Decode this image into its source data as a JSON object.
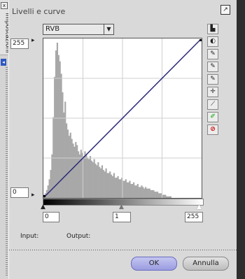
{
  "sidebar": {
    "label": "Impostazioni",
    "close_glyph": "x",
    "arrow_glyph": "◂"
  },
  "dialog": {
    "title": "Livelli e curve",
    "popout_icon": "↗",
    "channel": "RVB",
    "dropdown_icon": "▼",
    "output_max": "255",
    "output_min": "0",
    "input_black": "0",
    "gamma": "1",
    "input_white": "255",
    "input_label": "Input:",
    "output_label": "Output:",
    "ok_label": "OK",
    "cancel_label": "Annulla"
  },
  "tools": [
    {
      "name": "histogram-tool-icon",
      "glyph": "▙"
    },
    {
      "name": "contrast-tool-icon",
      "glyph": "◐"
    },
    {
      "name": "white-eyedropper-icon",
      "glyph": "✎"
    },
    {
      "name": "gray-eyedropper-icon",
      "glyph": "✎"
    },
    {
      "name": "black-eyedropper-icon",
      "glyph": "✎"
    },
    {
      "name": "crosshair-tool-icon",
      "glyph": "✛"
    },
    {
      "name": "curve-tool-icon",
      "glyph": "⟋"
    },
    {
      "name": "pencil-curve-icon",
      "glyph": "✐"
    },
    {
      "name": "reset-icon",
      "glyph": "⊘"
    }
  ],
  "histogram": [
    2,
    3,
    5,
    8,
    12,
    18,
    28,
    52,
    78,
    95,
    100,
    92,
    88,
    80,
    68,
    55,
    62,
    48,
    44,
    40,
    42,
    38,
    35,
    33,
    36,
    34,
    30,
    28,
    31,
    29,
    27,
    30,
    28,
    26,
    25,
    27,
    24,
    23,
    25,
    22,
    21,
    23,
    20,
    19,
    21,
    18,
    17,
    19,
    16,
    16,
    17,
    15,
    14,
    16,
    13,
    13,
    14,
    12,
    12,
    13,
    11,
    11,
    12,
    10,
    10,
    11,
    9,
    9,
    10,
    8,
    8,
    9,
    7,
    7,
    8,
    7,
    6,
    7,
    6,
    6,
    6,
    5,
    5,
    5,
    4,
    4,
    4,
    3,
    3,
    3,
    2,
    2,
    2,
    1,
    1,
    1,
    1,
    0,
    0,
    0,
    0,
    0,
    0,
    0,
    0,
    0,
    0,
    0,
    0,
    0,
    0,
    0,
    0,
    0,
    0,
    0,
    0,
    0,
    0,
    0
  ]
}
